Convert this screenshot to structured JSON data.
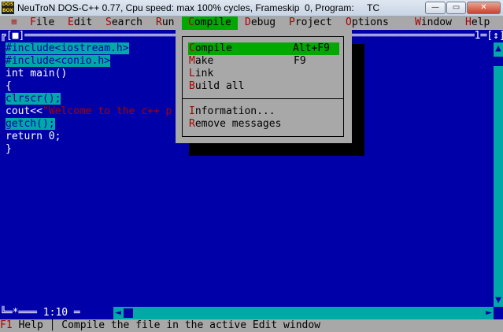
{
  "window": {
    "title": "NeuTroN DOS-C++ 0.77, Cpu speed: max 100% cycles, Frameskip  0, Program:     TC",
    "app_icon_text_top": "DOS",
    "app_icon_text_bottom": "BOX",
    "minimize": "—",
    "maximize": "▭",
    "close": "✕"
  },
  "menubar": {
    "system": "≡",
    "file_hk": "F",
    "file_rest": "ile",
    "edit_hk": "E",
    "edit_rest": "dit",
    "search_hk": "S",
    "search_rest": "earch",
    "run_hk": "R",
    "run_rest": "un",
    "compile_hk": "C",
    "compile_rest": "ompile",
    "debug_hk": "D",
    "debug_rest": "ebug",
    "project_hk": "P",
    "project_rest": "roject",
    "options_hk": "O",
    "options_rest": "ptions",
    "window_hk": "W",
    "window_rest": "indow",
    "help_hk": "H",
    "help_rest": "elp"
  },
  "editor": {
    "frame_top_left": "╔[■]═════════════════════════════════════════════════════════════════════════1═[↕]╗",
    "frame_bottom_left": "╚═*═══ 1:10 ═",
    "cursor_position": "1:10",
    "window_number": "1",
    "lines": {
      "l1": "#include<iostream.h>",
      "l2": "#include<conio.h>",
      "l3": "int main()",
      "l4": "{",
      "l5": "clrscr();",
      "l6a": "cout<<",
      "l6b": "\"Welcome to the c++ p",
      "l7": "getch();",
      "l8": "return 0;",
      "l9": "}"
    }
  },
  "compile_menu": {
    "compile_hk": "C",
    "compile_rest": "ompile",
    "compile_shortcut": "Alt+F9",
    "make_hk": "M",
    "make_rest": "ake",
    "make_shortcut": "F9",
    "link_hk": "L",
    "link_rest": "ink",
    "buildall_hk": "B",
    "buildall_rest": "uild all",
    "information_hk": "I",
    "information_rest": "nformation...",
    "remove_hk": "R",
    "remove_rest": "emove messages"
  },
  "statusbar": {
    "key": "F1",
    "key_label": " Help ",
    "separator": "│",
    "message": " Compile the file in the active Edit window"
  },
  "scroll": {
    "up": "▲",
    "down": "▼",
    "left": "◄",
    "right": "►"
  },
  "colors": {
    "background": "#0000A8",
    "menu": "#A8A8A8",
    "highlight": "#00A800",
    "cyan": "#00A8A8",
    "hotkey": "#A80000"
  }
}
